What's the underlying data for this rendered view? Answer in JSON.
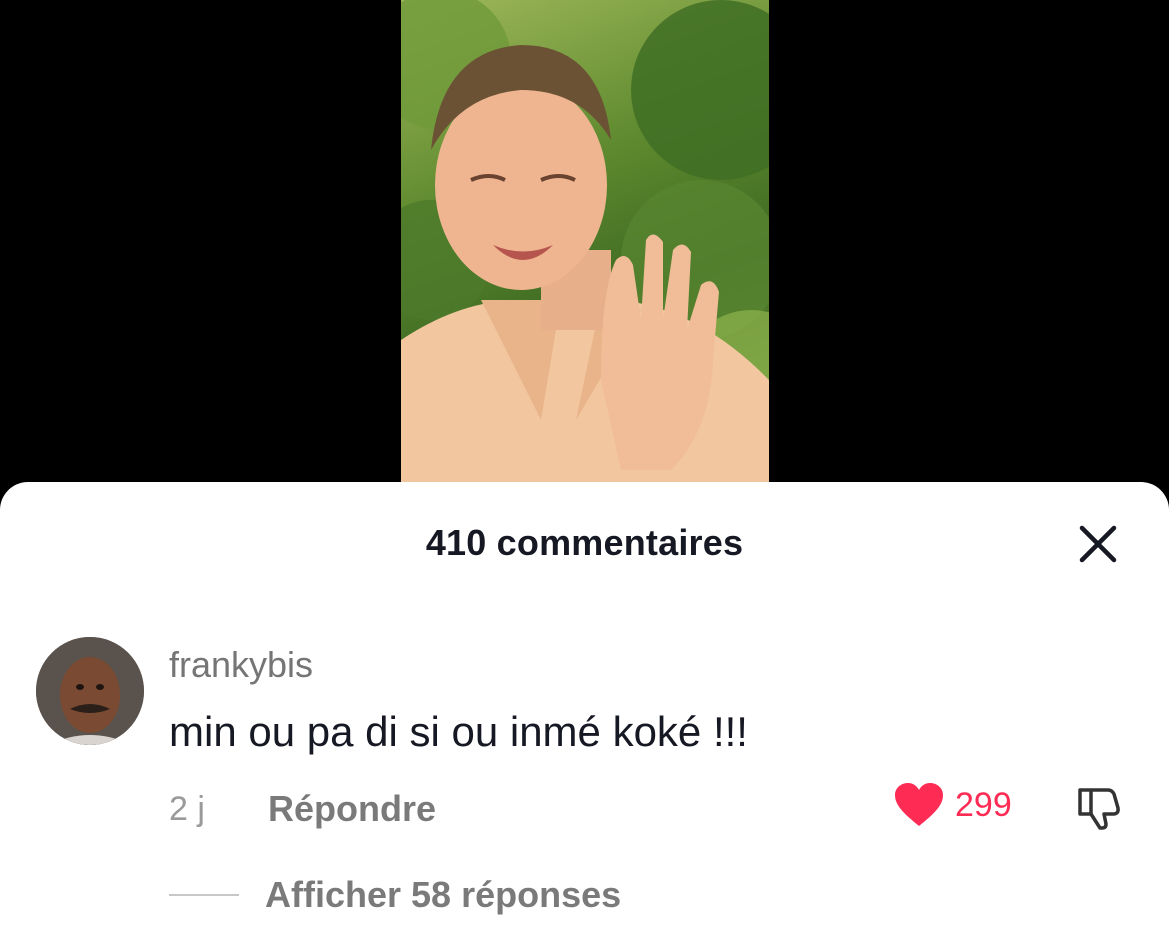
{
  "colors": {
    "accent_like": "#fe2c55",
    "text_primary": "#161823",
    "text_secondary": "#757575",
    "background_top": "#000000",
    "sheet_background": "#ffffff"
  },
  "video": {
    "description_icon": "video-player"
  },
  "sheet": {
    "title": "410 commentaires",
    "close_icon": "close-icon"
  },
  "comments": [
    {
      "username": "frankybis",
      "text": "min ou pa di si ou inmé koké !!!",
      "time": "2 j",
      "reply_label": "Répondre",
      "likes": "299",
      "like_icon": "heart-icon",
      "dislike_icon": "thumbs-down-icon",
      "replies_label": "Afficher 58 réponses"
    }
  ]
}
